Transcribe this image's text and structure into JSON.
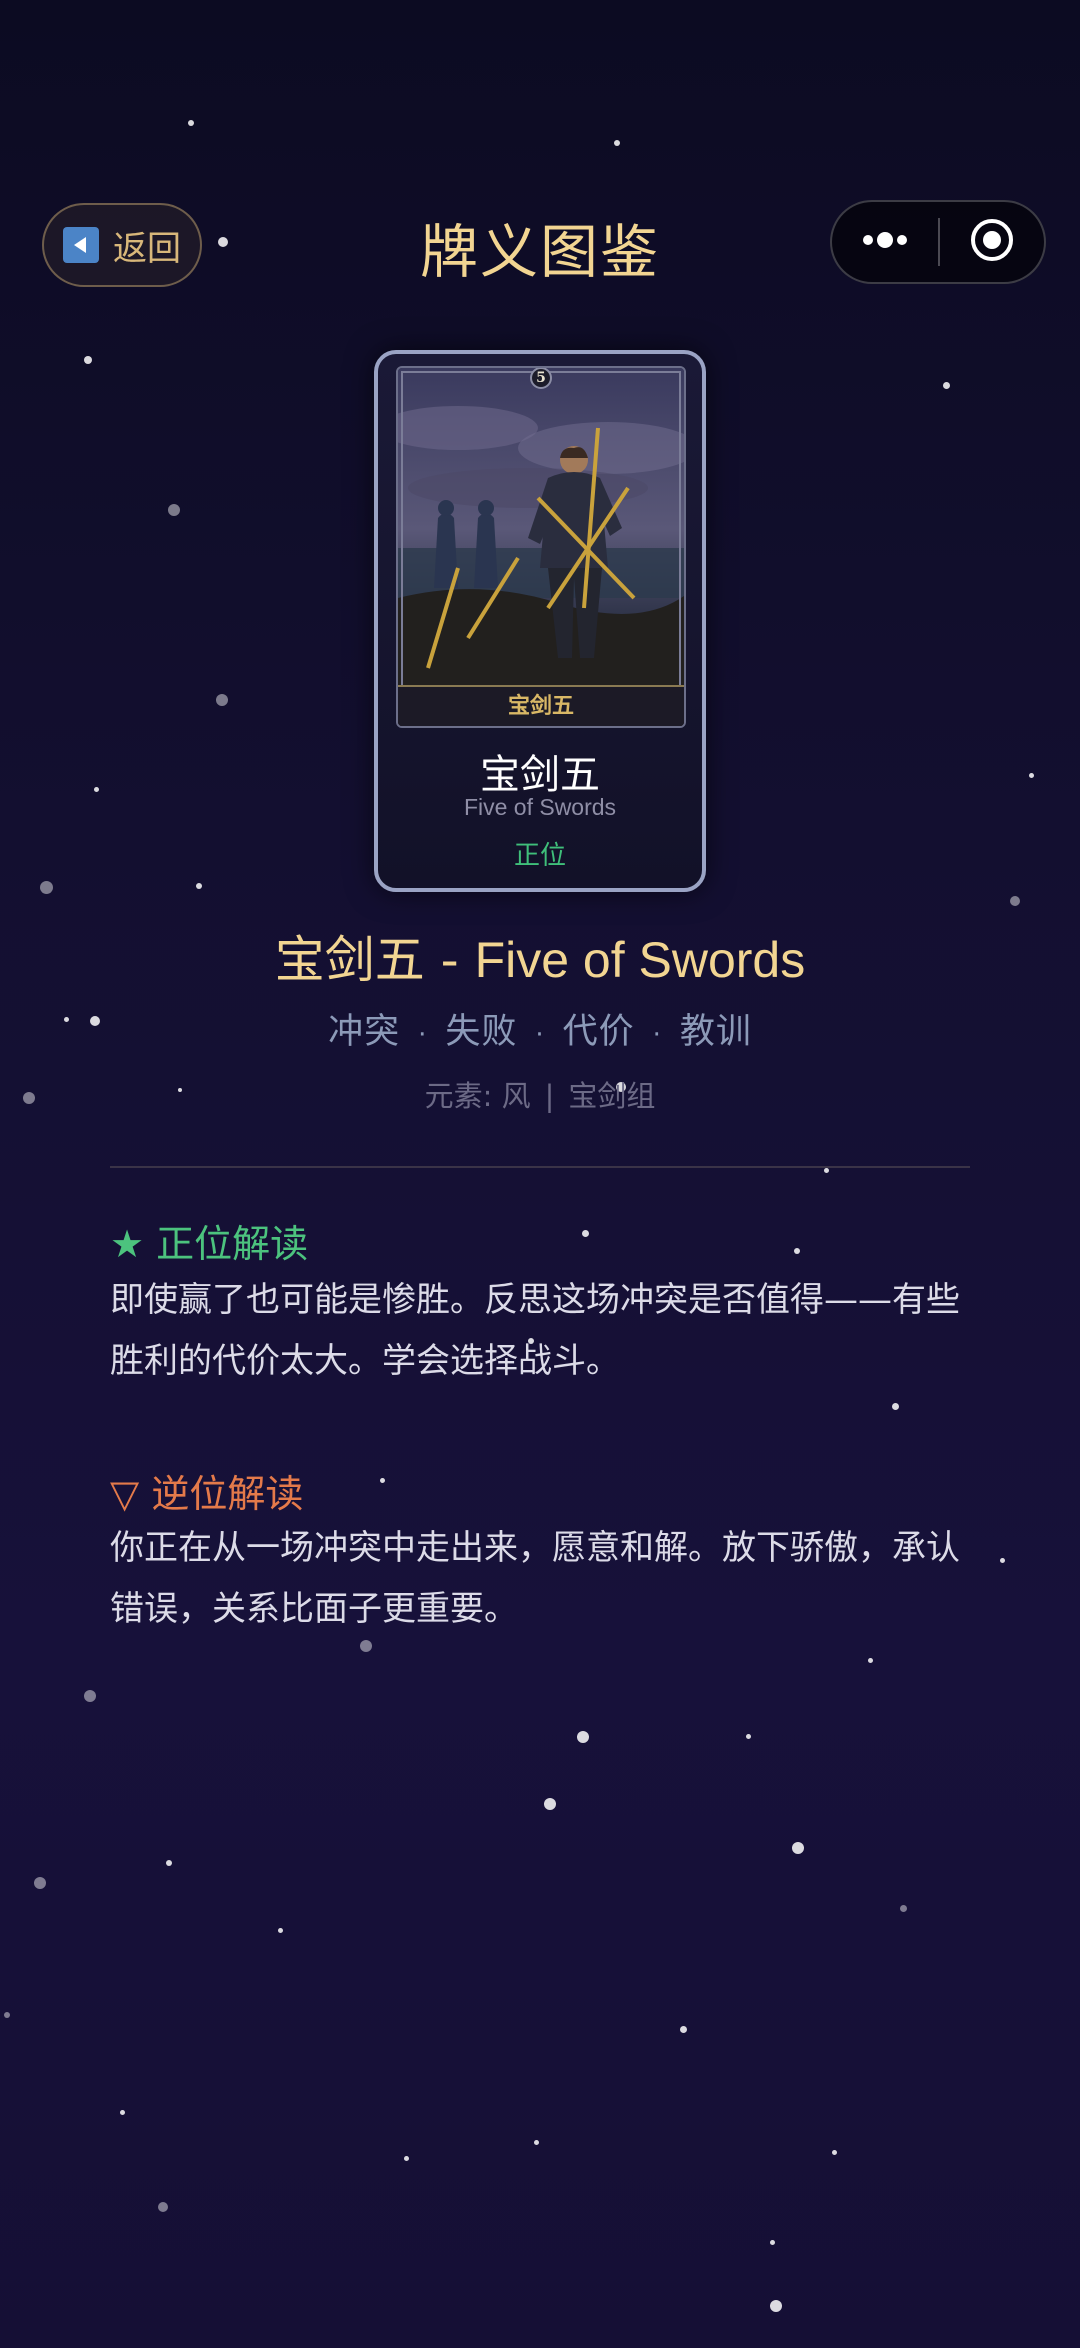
{
  "header": {
    "back_label": "返回",
    "title": "牌义图鉴"
  },
  "capsule": {
    "more_icon": "more-dots-icon",
    "close_icon": "target-circle-icon"
  },
  "card": {
    "art_caption": "宝剑五",
    "art_number": "5",
    "name_cn": "宝剑五",
    "name_en": "Five of Swords",
    "orientation": "正位"
  },
  "detail": {
    "title_cn": "宝剑五",
    "title_sep": " - ",
    "title_en": "Five of Swords",
    "keywords": [
      "冲突",
      "失败",
      "代价",
      "教训"
    ],
    "element_label": "元素: 风",
    "suit_label": "宝剑组"
  },
  "upright": {
    "icon": "★",
    "heading": "正位解读",
    "text": "即使赢了也可能是惨胜。反思这场冲突是否值得——有些胜利的代价太大。学会选择战斗。"
  },
  "reversed": {
    "icon": "▽",
    "heading": "逆位解读",
    "text": "你正在从一场冲突中走出来，愿意和解。放下骄傲，承认错误，关系比面子更重要。"
  },
  "colors": {
    "background": "#130f30",
    "title_gold": "#f2d592",
    "upright_green": "#4cc37e",
    "reversed_orange": "#e47a4a",
    "keyword_blue_gray": "#8c9ab8"
  }
}
